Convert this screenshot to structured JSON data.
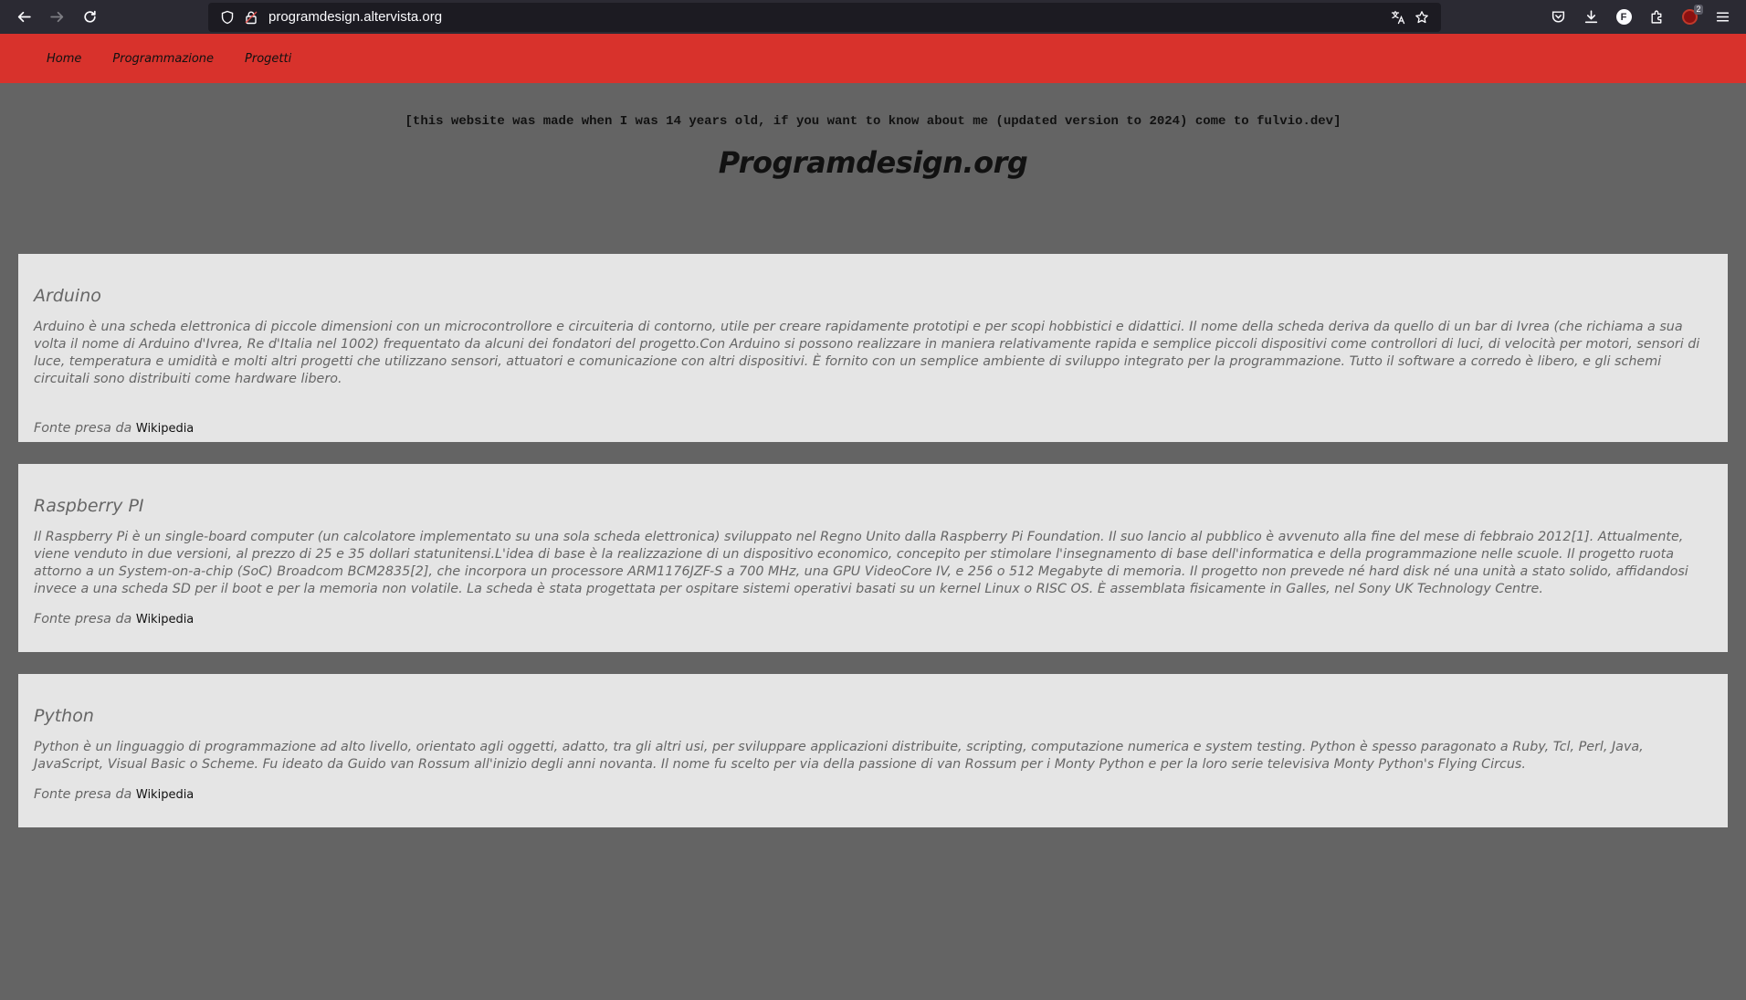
{
  "browser": {
    "url": "programdesign.altervista.org",
    "extension_badge_count": "2",
    "profile_initial": "F"
  },
  "nav": {
    "items": [
      {
        "label": "Home"
      },
      {
        "label": "Programmazione"
      },
      {
        "label": "Progetti"
      }
    ]
  },
  "header": {
    "notice": "[this website was made when I was 14 years old, if you want to know about me (updated version to 2024) come to fulvio.dev]",
    "title": "Programdesign.org"
  },
  "cards": [
    {
      "title": "Arduino",
      "body": "Arduino è una scheda elettronica di piccole dimensioni con un microcontrollore e circuiteria di contorno, utile per creare rapidamente prototipi e per scopi hobbistici e didattici. Il nome della scheda deriva da quello di un bar di Ivrea (che richiama a sua volta il nome di Arduino d'Ivrea, Re d'Italia nel 1002) frequentato da alcuni dei fondatori del progetto.Con Arduino si possono realizzare in maniera relativamente rapida e semplice piccoli dispositivi come controllori di luci, di velocità per motori, sensori di luce, temperatura e umidità e molti altri progetti che utilizzano sensori, attuatori e comunicazione con altri dispositivi. È fornito con un semplice ambiente di sviluppo integrato per la programmazione. Tutto il software a corredo è libero, e gli schemi circuitali sono distribuiti come hardware libero.",
      "source_prefix": "Fonte presa da",
      "source_link": "Wikipedia"
    },
    {
      "title": "Raspberry PI",
      "body": "Il Raspberry Pi è un single-board computer (un calcolatore implementato su una sola scheda elettronica) sviluppato nel Regno Unito dalla Raspberry Pi Foundation. Il suo lancio al pubblico è avvenuto alla fine del mese di febbraio 2012[1]. Attualmente, viene venduto in due versioni, al prezzo di 25 e 35 dollari statunitensi.L'idea di base è la realizzazione di un dispositivo economico, concepito per stimolare l'insegnamento di base dell'informatica e della programmazione nelle scuole. Il progetto ruota attorno a un System-on-a-chip (SoC) Broadcom BCM2835[2], che incorpora un processore ARM1176JZF-S a 700 MHz, una GPU VideoCore IV, e 256 o 512 Megabyte di memoria. Il progetto non prevede né hard disk né una unità a stato solido, affidandosi invece a una scheda SD per il boot e per la memoria non volatile. La scheda è stata progettata per ospitare sistemi operativi basati su un kernel Linux o RISC OS. È assemblata fisicamente in Galles, nel Sony UK Technology Centre.",
      "source_prefix": "Fonte presa da",
      "source_link": "Wikipedia"
    },
    {
      "title": "Python",
      "body": "Python è un linguaggio di programmazione ad alto livello, orientato agli oggetti, adatto, tra gli altri usi, per sviluppare applicazioni distribuite, scripting, computazione numerica e system testing. Python è spesso paragonato a Ruby, Tcl, Perl, Java, JavaScript, Visual Basic o Scheme. Fu ideato da Guido van Rossum all'inizio degli anni novanta. Il nome fu scelto per via della passione di van Rossum per i Monty Python e per la loro serie televisiva Monty Python's Flying Circus.",
      "source_prefix": "Fonte presa da",
      "source_link": "Wikipedia"
    }
  ],
  "colors": {
    "nav_bg": "#d8322c",
    "page_bg": "#646464",
    "card_bg": "#e5e5e5",
    "chrome_bg": "#2b2a33"
  },
  "icons": [
    "back-icon",
    "forward-icon",
    "reload-icon",
    "shield-icon",
    "lock-icon",
    "translate-icon",
    "bookmark-star-icon",
    "pocket-icon",
    "download-icon",
    "extensions-icon",
    "ublock-icon",
    "menu-icon"
  ]
}
